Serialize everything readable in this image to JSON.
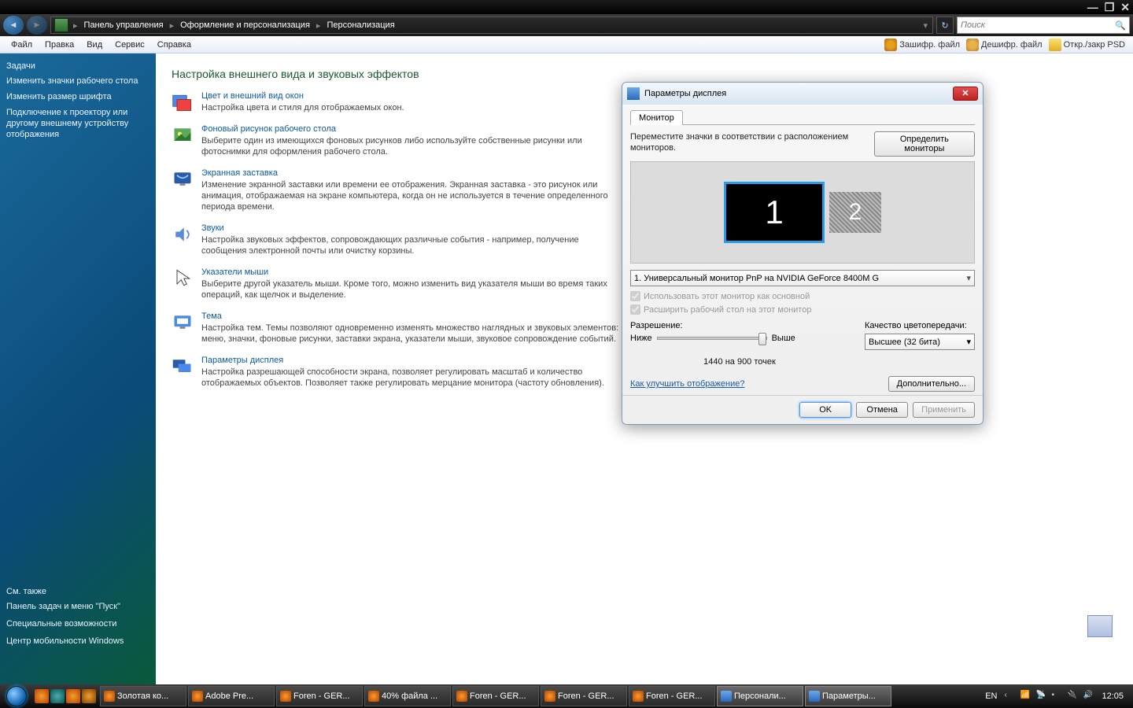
{
  "titlebar": {
    "min": "—",
    "max": "❐",
    "close": "✕"
  },
  "navbar": {
    "crumbs": [
      "Панель управления",
      "Оформление и персонализация",
      "Персонализация"
    ],
    "search_placeholder": "Поиск"
  },
  "menubar": {
    "items": [
      "Файл",
      "Правка",
      "Вид",
      "Сервис",
      "Справка"
    ],
    "tools": [
      "Зашифр. файл",
      "Дешифр. файл",
      "Откр./закр PSD"
    ]
  },
  "sidebar": {
    "header": "Задачи",
    "links": [
      "Изменить значки рабочего стола",
      "Изменить размер шрифта",
      "Подключение к проектору или другому внешнему устройству отображения"
    ],
    "seealso_header": "См. также",
    "seealso": [
      "Панель задач и меню \"Пуск\"",
      "Специальные возможности",
      "Центр мобильности Windows"
    ]
  },
  "content": {
    "title": "Настройка внешнего вида и звуковых эффектов",
    "cats": [
      {
        "title": "Цвет и внешний вид окон",
        "desc": "Настройка цвета и стиля для отображаемых окон."
      },
      {
        "title": "Фоновый рисунок рабочего стола",
        "desc": "Выберите один из имеющихся фоновых рисунков либо используйте собственные рисунки или фотоснимки для оформления рабочего стола."
      },
      {
        "title": "Экранная заставка",
        "desc": "Изменение экранной заставки или времени ее отображения. Экранная заставка - это рисунок или анимация, отображаемая на экране компьютера, когда он не используется в течение определенного периода времени."
      },
      {
        "title": "Звуки",
        "desc": "Настройка звуковых эффектов, сопровождающих различные события - например, получение сообщения электронной почты или очистку корзины."
      },
      {
        "title": "Указатели мыши",
        "desc": "Выберите другой указатель мыши. Кроме того, можно изменить вид указателя мыши во время таких операций, как щелчок и выделение."
      },
      {
        "title": "Тема",
        "desc": "Настройка тем. Темы позволяют одновременно изменять множество наглядных и звуковых элементов: меню, значки, фоновые рисунки, заставки экрана, указатели мыши, звуковое сопровождение событий."
      },
      {
        "title": "Параметры дисплея",
        "desc": "Настройка разрешающей способности экрана, позволяет регулировать масштаб и количество отображаемых объектов. Позволяет также регулировать мерцание монитора (частоту обновления)."
      }
    ]
  },
  "dialog": {
    "title": "Параметры дисплея",
    "tab": "Монитор",
    "instruction": "Переместите значки в соответствии с расположением мониторов.",
    "identify_btn": "Определить мониторы",
    "mon1": "1",
    "mon2": "2",
    "monitor_select": "1. Универсальный монитор PnP на NVIDIA GeForce 8400M G",
    "chk_primary": "Использовать этот монитор как основной",
    "chk_extend": "Расширить рабочий стол на этот монитор",
    "res_label": "Разрешение:",
    "res_lo": "Ниже",
    "res_hi": "Выше",
    "res_value": "1440 на 900 точек",
    "quality_label": "Качество цветопередачи:",
    "quality_value": "Высшее (32 бита)",
    "improve_link": "Как улучшить отображение?",
    "advanced_btn": "Дополнительно...",
    "ok": "OK",
    "cancel": "Отмена",
    "apply": "Применить"
  },
  "taskbar": {
    "buttons": [
      {
        "icon": "ff",
        "label": "Золотая ко..."
      },
      {
        "icon": "ff",
        "label": "Adobe Pre..."
      },
      {
        "icon": "ff",
        "label": "Foren - GER..."
      },
      {
        "icon": "ff",
        "label": "40% файла ..."
      },
      {
        "icon": "ff",
        "label": "Foren - GER..."
      },
      {
        "icon": "ff",
        "label": "Foren - GER..."
      },
      {
        "icon": "ff",
        "label": "Foren - GER..."
      },
      {
        "icon": "cp",
        "label": "Персонали...",
        "active": true
      },
      {
        "icon": "cp",
        "label": "Параметры...",
        "active": true
      }
    ],
    "lang": "EN",
    "clock": "12:05"
  }
}
